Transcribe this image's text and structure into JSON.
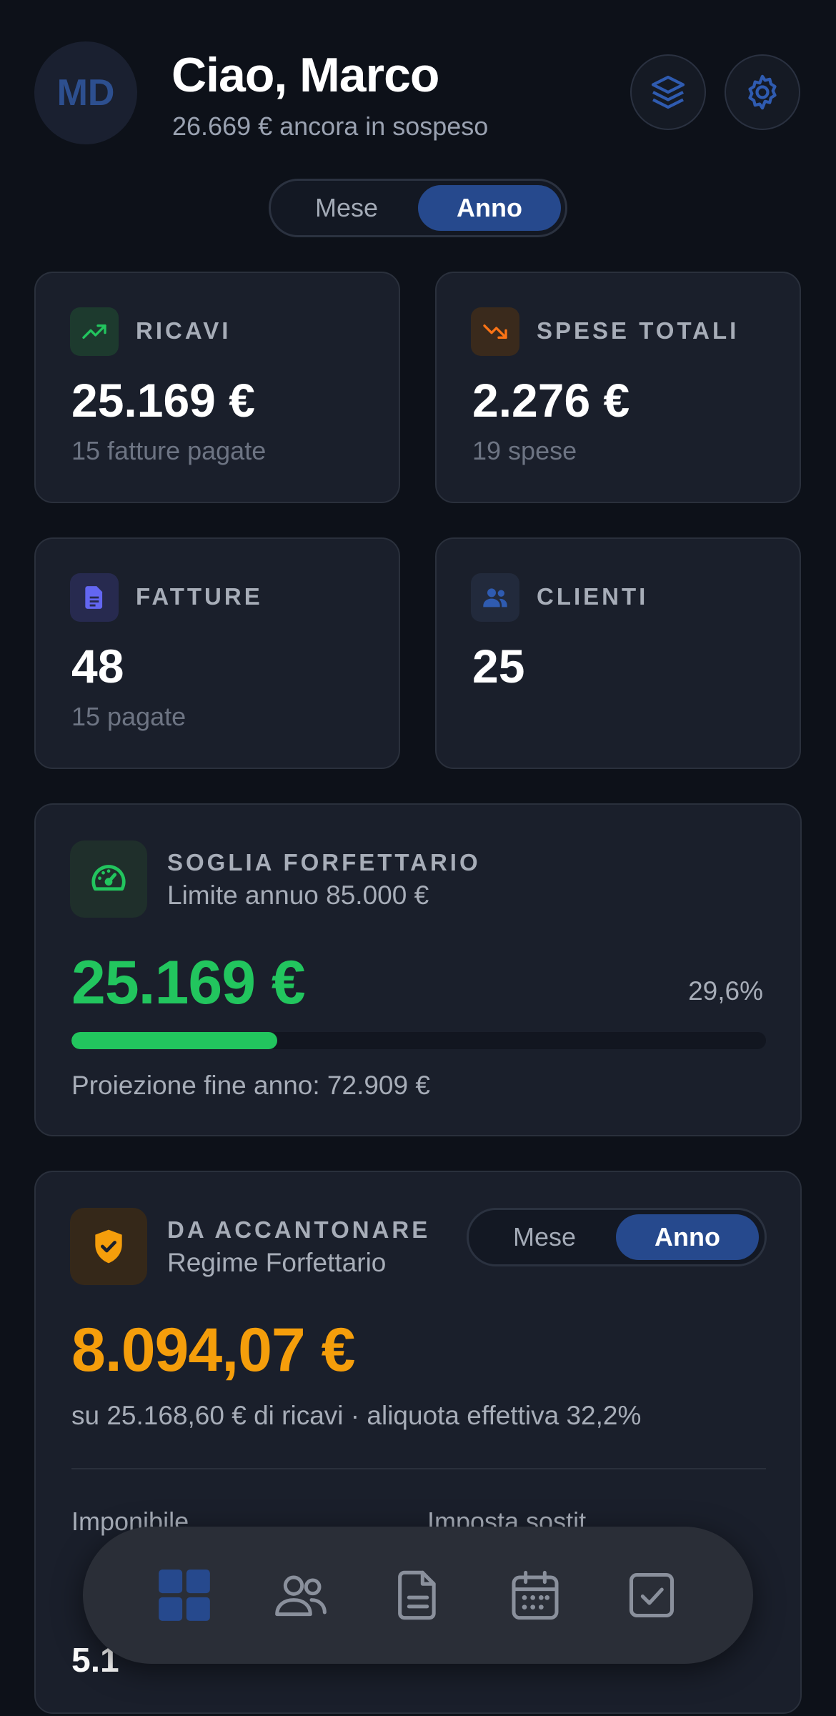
{
  "header": {
    "avatar_initials": "MD",
    "greeting": "Ciao, Marco",
    "pending": "26.669 € ancora in sospeso",
    "icons": [
      "layers-icon",
      "gear-icon"
    ]
  },
  "period_toggle": {
    "options": [
      "Mese",
      "Anno"
    ],
    "selected": "Anno"
  },
  "stats": {
    "ricavi": {
      "label": "RICAVI",
      "value": "25.169 €",
      "sub": "15 fatture pagate",
      "icon": "trending-up-icon",
      "color": "#22c55e"
    },
    "spese": {
      "label": "SPESE TOTALI",
      "value": "2.276 €",
      "sub": "19 spese",
      "icon": "trending-down-icon",
      "color": "#f97316"
    },
    "fatture": {
      "label": "FATTURE",
      "value": "48",
      "sub": "15 pagate",
      "icon": "document-icon",
      "color": "#6366f1"
    },
    "clienti": {
      "label": "CLIENTI",
      "value": "25",
      "icon": "users-icon",
      "color": "#2d4f8f"
    }
  },
  "soglia": {
    "title": "SOGLIA FORFETTARIO",
    "subtitle": "Limite annuo 85.000 €",
    "value": "25.169 €",
    "percent_text": "29,6%",
    "progress": 0.296,
    "projection": "Proiezione fine anno: 72.909 €",
    "icon": "gauge-icon",
    "color": "#22c55e"
  },
  "accantonare": {
    "title": "DA ACCANTONARE",
    "subtitle": "Regime Forfettario",
    "toggle": {
      "options": [
        "Mese",
        "Anno"
      ],
      "selected": "Anno"
    },
    "value": "8.094,07 €",
    "description": "su 25.168,60 € di ricavi · aliquota effettiva 32,2%",
    "icon": "shield-check-icon",
    "color": "#f59e0b",
    "rows": [
      {
        "label": "Imponibile",
        "value": ""
      },
      {
        "label": "Imposta sostit.",
        "value": ""
      },
      {
        "label": "",
        "value": "5.1"
      },
      {
        "label": "",
        "value": ""
      }
    ]
  },
  "bottom_nav": {
    "items": [
      "dashboard-icon",
      "users-icon",
      "document-icon",
      "calendar-icon",
      "checkbox-icon"
    ],
    "active": "dashboard-icon",
    "active_color": "#26498d",
    "inactive_color": "#8a909c"
  }
}
